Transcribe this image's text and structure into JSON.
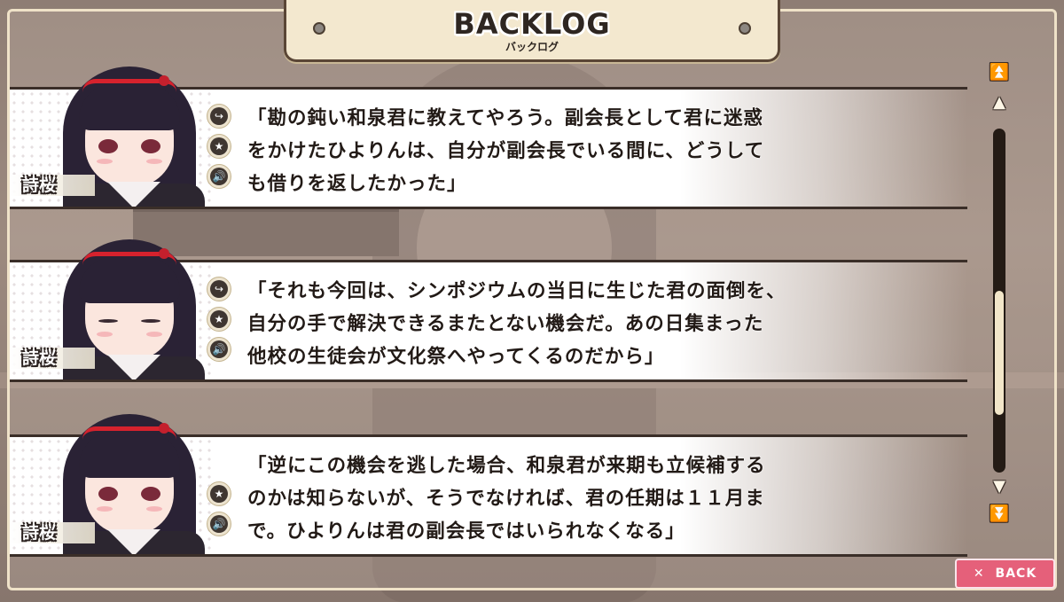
{
  "title": {
    "main": "BACKLOG",
    "sub": "バックログ"
  },
  "entries": [
    {
      "speaker": "詩桜",
      "expression": "open-eyes",
      "text": "「勘の鈍い和泉君に教えてやろう。副会長として君に迷惑\nをかけたひよりんは、自分が副会長でいる間に、どうして\nも借りを返したかった」",
      "buttons": [
        "jump",
        "favorite",
        "voice"
      ]
    },
    {
      "speaker": "詩桜",
      "expression": "closed-eyes",
      "text": "「それも今回は、シンポジウムの当日に生じた君の面倒を、\n自分の手で解決できるまたとない機会だ。あの日集まった\n他校の生徒会が文化祭へやってくるのだから」",
      "buttons": [
        "jump",
        "favorite",
        "voice"
      ]
    },
    {
      "speaker": "詩桜",
      "expression": "open-eyes",
      "text": "「逆にこの機会を逃した場合、和泉君が来期も立候補する\nのかは知らないが、そうでなければ、君の任期は１１月ま\nで。ひよりんは君の副会長ではいられなくなる」",
      "buttons": [
        "favorite",
        "voice"
      ]
    }
  ],
  "icons": {
    "jump": "↪",
    "favorite": "★",
    "voice": "🔊",
    "page_up": "⏫",
    "line_up": "▲",
    "line_down": "▼",
    "page_down": "⏬"
  },
  "scroll": {
    "position": 0.74,
    "visible_fraction": 0.37
  },
  "back_button": {
    "icon": "✕",
    "label": "BACK"
  },
  "colors": {
    "accent": "#e5607a",
    "frame": "#efe2c8",
    "dark": "#3a2e28"
  }
}
